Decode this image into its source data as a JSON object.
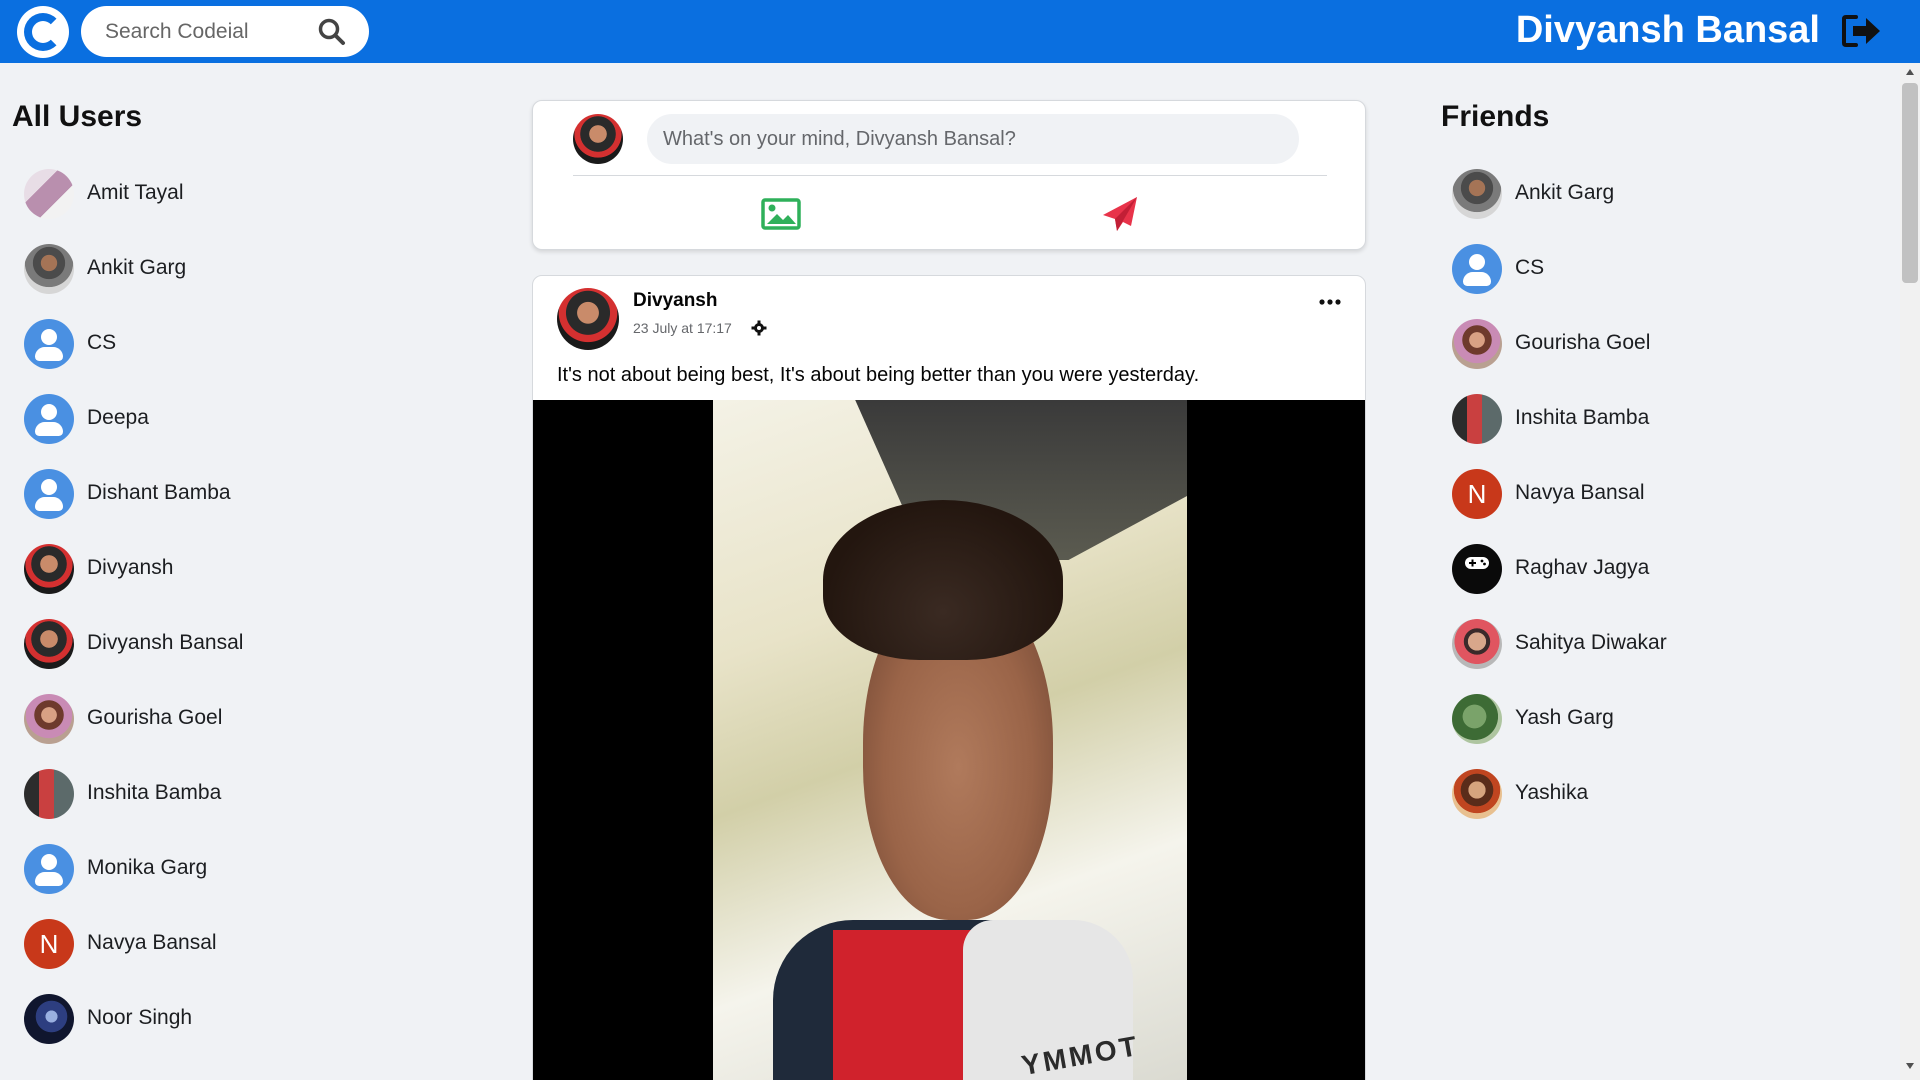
{
  "app": {
    "search_placeholder": "Search Codeial",
    "current_user": "Divyansh Bansal"
  },
  "all_users": {
    "title": "All Users",
    "items": [
      {
        "name": "Amit Tayal"
      },
      {
        "name": "Ankit Garg"
      },
      {
        "name": "CS"
      },
      {
        "name": "Deepa"
      },
      {
        "name": "Dishant Bamba"
      },
      {
        "name": "Divyansh"
      },
      {
        "name": "Divyansh Bansal"
      },
      {
        "name": "Gourisha Goel"
      },
      {
        "name": "Inshita Bamba"
      },
      {
        "name": "Monika Garg"
      },
      {
        "name": "Navya Bansal",
        "initial": "N"
      },
      {
        "name": "Noor Singh"
      }
    ]
  },
  "composer": {
    "placeholder": "What's on your mind, Divyansh Bansal?"
  },
  "post": {
    "author": "Divyansh",
    "time": "23 July at 17:17",
    "text": "It's not about being best, It's about being better than you were yesterday.",
    "photo_caption": "YMMOT"
  },
  "friends": {
    "title": "Friends",
    "items": [
      {
        "name": "Ankit Garg"
      },
      {
        "name": "CS"
      },
      {
        "name": "Gourisha Goel"
      },
      {
        "name": "Inshita Bamba"
      },
      {
        "name": "Navya Bansal",
        "initial": "N"
      },
      {
        "name": "Raghav Jagya"
      },
      {
        "name": "Sahitya Diwakar"
      },
      {
        "name": "Yash Garg"
      },
      {
        "name": "Yashika"
      }
    ]
  },
  "colors": {
    "brand_blue": "#0a6fe0",
    "photo_icon_green": "#2fb05a",
    "send_icon_red": "#e8334a",
    "letter_avatar": "#c8381a"
  },
  "icons": {
    "search": "search-icon",
    "logout": "logout-icon",
    "photo": "image-icon",
    "send": "paper-plane-icon",
    "settings": "gear-icon",
    "more": "more-dots-icon"
  }
}
